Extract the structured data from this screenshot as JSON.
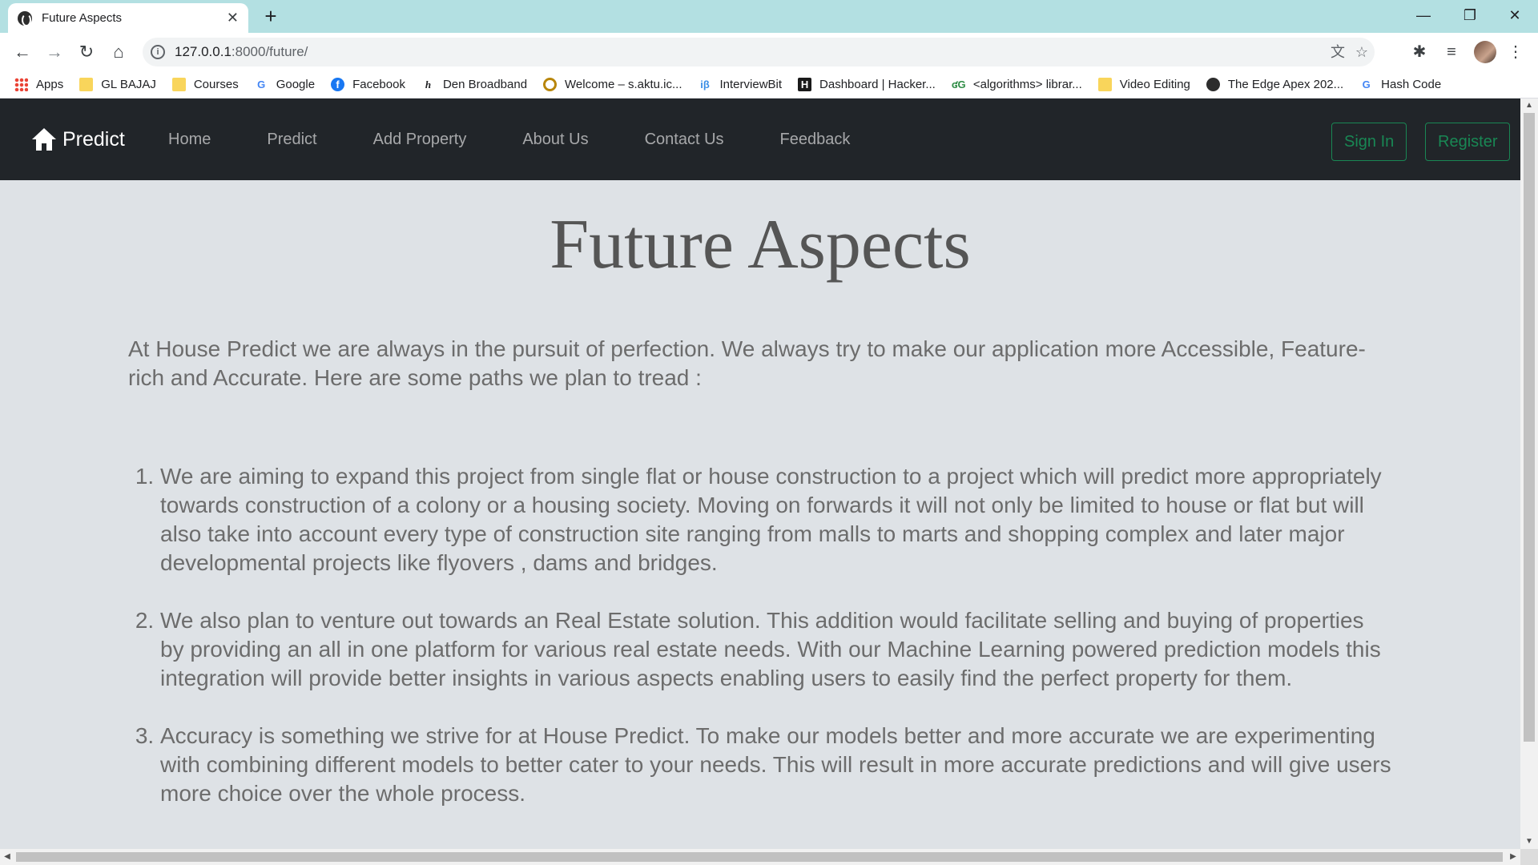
{
  "browser": {
    "tab_title": "Future Aspects",
    "url_host": "127.0.0.1",
    "url_rest": ":8000/future/",
    "bookmarks": [
      {
        "label": "Apps",
        "icon": "apps-grid-icon"
      },
      {
        "label": "GL BAJAJ",
        "icon": "folder-icon"
      },
      {
        "label": "Courses",
        "icon": "folder-icon"
      },
      {
        "label": "Google",
        "icon": "google-icon"
      },
      {
        "label": "Facebook",
        "icon": "facebook-icon"
      },
      {
        "label": "Den Broadband",
        "icon": "den-icon"
      },
      {
        "label": "Welcome – s.aktu.ic...",
        "icon": "aktu-icon"
      },
      {
        "label": "InterviewBit",
        "icon": "interviewbit-icon"
      },
      {
        "label": "Dashboard | Hacker...",
        "icon": "hackerrank-icon"
      },
      {
        "label": "<algorithms> librar...",
        "icon": "gfg-icon"
      },
      {
        "label": "Video Editing",
        "icon": "folder-icon"
      },
      {
        "label": "The Edge Apex 202...",
        "icon": "globe-icon"
      },
      {
        "label": "Hash Code",
        "icon": "google-icon"
      }
    ]
  },
  "navbar": {
    "brand": "Predict",
    "links": [
      "Home",
      "Predict",
      "Add Property",
      "About Us",
      "Contact Us",
      "Feedback"
    ],
    "sign_in": "Sign In",
    "register": "Register"
  },
  "main": {
    "title": "Future Aspects",
    "intro": "At House Predict we are always in the pursuit of perfection. We always try to make our application more Accessible, Feature-rich and Accurate. Here are some paths we plan to tread :",
    "plans": [
      "We are aiming to expand this project from single flat or house construction to a project which will predict more appropriately towards construction of a colony or a housing society. Moving on forwards it will not only be limited to house or flat but will also take into account every type of construction site ranging from malls to marts and shopping complex and later major developmental projects like flyovers , dams and bridges.",
      "We also plan to venture out towards an Real Estate solution. This addition would facilitate selling and buying of properties by providing an all in one platform for various real estate needs. With our Machine Learning powered prediction models this integration will provide better insights in various aspects enabling users to easily find the perfect property for them.",
      "Accuracy is something we strive for at House Predict. To make our models better and more accurate we are experimenting with combining different models to better cater to your needs. This will result in more accurate predictions and will give users more choice over the whole process."
    ]
  },
  "colors": {
    "navbar_bg": "#212529",
    "page_bg": "#dee2e6",
    "accent_green": "#198754",
    "tabstrip_bg": "#b3e0e2"
  }
}
